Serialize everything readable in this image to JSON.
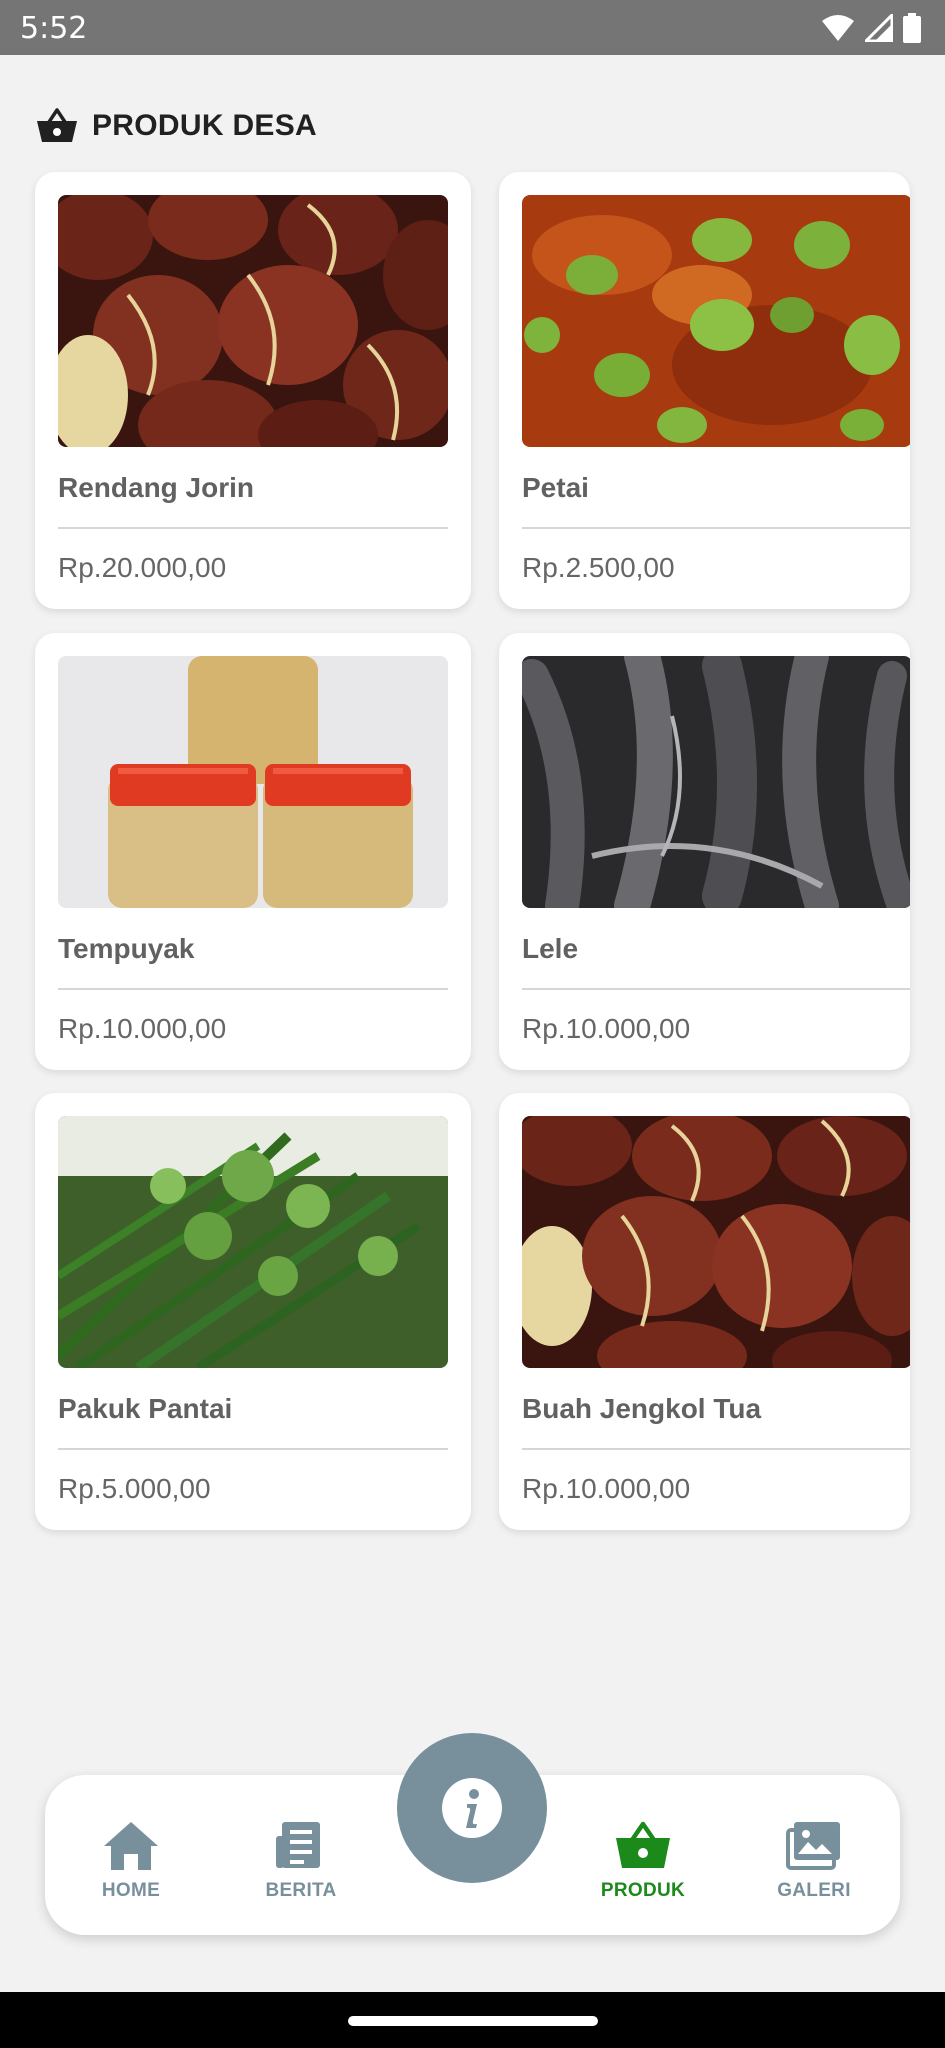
{
  "status_bar": {
    "time": "5:52",
    "icons": [
      "wifi-icon",
      "signal-icon",
      "battery-icon"
    ]
  },
  "header": {
    "title": "PRODUK DESA",
    "icon": "shopping-basket-icon"
  },
  "products": [
    {
      "name": "Rendang Jorin",
      "price": "Rp.20.000,00",
      "image": "jengkol-beans"
    },
    {
      "name": "Petai",
      "price": "Rp.2.500,00",
      "image": "petai-sambal"
    },
    {
      "name": "Tempuyak",
      "price": "Rp.10.000,00",
      "image": "tempuyak-jars"
    },
    {
      "name": "Lele",
      "price": "Rp.10.000,00",
      "image": "catfish"
    },
    {
      "name": "Pakuk Pantai",
      "price": "Rp.5.000,00",
      "image": "fern-shoots"
    },
    {
      "name": "Buah Jengkol Tua",
      "price": "Rp.10.000,00",
      "image": "jengkol-beans"
    }
  ],
  "bottom_nav": {
    "items": [
      {
        "label": "HOME",
        "icon": "home-icon"
      },
      {
        "label": "BERITA",
        "icon": "newspaper-icon"
      },
      {
        "label": "PRODUK",
        "icon": "shopping-basket-icon",
        "active": true
      },
      {
        "label": "GALERI",
        "icon": "gallery-icon"
      }
    ],
    "fab_icon": "info-icon"
  },
  "colors": {
    "accent": "#1b8a1b",
    "inactive": "#78909c",
    "status_bar": "#757575",
    "background": "#f2f2f2"
  }
}
